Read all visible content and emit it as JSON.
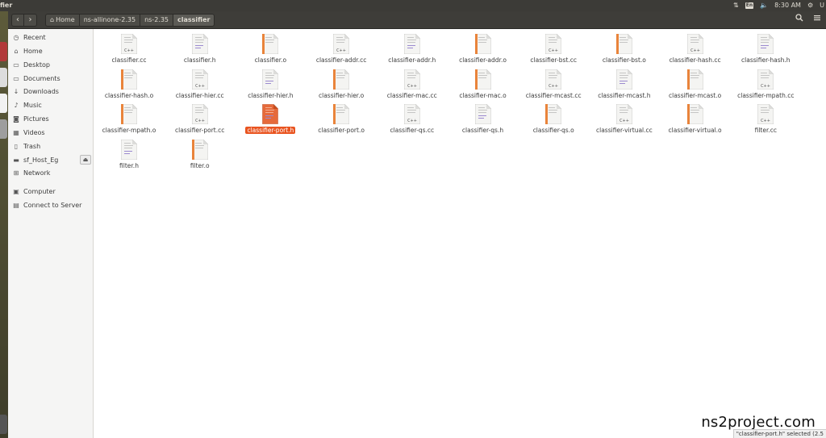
{
  "window": {
    "title_fragment": "fier"
  },
  "top_panel": {
    "network_icon": "arrows-up-down-icon",
    "keyboard": "En",
    "volume_icon": "speaker-icon",
    "time": "8:30 AM",
    "settings_icon": "gear-icon",
    "user_fragment": "U"
  },
  "nav": {
    "back": "‹",
    "forward": "›"
  },
  "breadcrumbs": [
    "Home",
    "ns-allinone-2.35",
    "ns-2.35",
    "classifier"
  ],
  "header_actions": {
    "search_icon": "search-icon",
    "menu_icon": "hamburger-menu-icon"
  },
  "sidebar": {
    "items": [
      {
        "label": "Recent",
        "icon": "clock-icon"
      },
      {
        "label": "Home",
        "icon": "home-icon"
      },
      {
        "label": "Desktop",
        "icon": "desktop-folder-icon"
      },
      {
        "label": "Documents",
        "icon": "documents-folder-icon"
      },
      {
        "label": "Downloads",
        "icon": "download-arrow-icon"
      },
      {
        "label": "Music",
        "icon": "music-note-icon"
      },
      {
        "label": "Pictures",
        "icon": "camera-icon"
      },
      {
        "label": "Videos",
        "icon": "film-icon"
      },
      {
        "label": "Trash",
        "icon": "trash-icon"
      },
      {
        "label": "sf_Host_Eg",
        "icon": "drive-icon",
        "eject": true
      },
      {
        "label": "Network",
        "icon": "network-icon"
      },
      {
        "label": "Computer",
        "icon": "computer-icon"
      },
      {
        "label": "Connect to Server",
        "icon": "server-icon"
      }
    ]
  },
  "files": [
    {
      "name": "classifier.cc",
      "kind": "cc"
    },
    {
      "name": "classifier.h",
      "kind": "h"
    },
    {
      "name": "classifier.o",
      "kind": "o"
    },
    {
      "name": "classifier-addr.cc",
      "kind": "cc"
    },
    {
      "name": "classifier-addr.h",
      "kind": "h"
    },
    {
      "name": "classifier-addr.o",
      "kind": "o"
    },
    {
      "name": "classifier-bst.cc",
      "kind": "cc"
    },
    {
      "name": "classifier-bst.o",
      "kind": "o"
    },
    {
      "name": "classifier-hash.cc",
      "kind": "cc"
    },
    {
      "name": "classifier-hash.h",
      "kind": "h"
    },
    {
      "name": "classifier-hash.o",
      "kind": "o"
    },
    {
      "name": "classifier-hier.cc",
      "kind": "cc"
    },
    {
      "name": "classifier-hier.h",
      "kind": "h"
    },
    {
      "name": "classifier-hier.o",
      "kind": "o"
    },
    {
      "name": "classifier-mac.cc",
      "kind": "cc"
    },
    {
      "name": "classifier-mac.o",
      "kind": "o"
    },
    {
      "name": "classifier-mcast.cc",
      "kind": "cc"
    },
    {
      "name": "classifier-mcast.h",
      "kind": "h"
    },
    {
      "name": "classifier-mcast.o",
      "kind": "o"
    },
    {
      "name": "classifier-mpath.cc",
      "kind": "cc"
    },
    {
      "name": "classifier-mpath.o",
      "kind": "o"
    },
    {
      "name": "classifier-port.cc",
      "kind": "cc"
    },
    {
      "name": "classifier-port.h",
      "kind": "h",
      "selected": true
    },
    {
      "name": "classifier-port.o",
      "kind": "o"
    },
    {
      "name": "classifier-qs.cc",
      "kind": "cc"
    },
    {
      "name": "classifier-qs.h",
      "kind": "h"
    },
    {
      "name": "classifier-qs.o",
      "kind": "o"
    },
    {
      "name": "classifier-virtual.cc",
      "kind": "cc"
    },
    {
      "name": "classifier-virtual.o",
      "kind": "o"
    },
    {
      "name": "filter.cc",
      "kind": "cc"
    },
    {
      "name": "filter.h",
      "kind": "h"
    },
    {
      "name": "filter.o",
      "kind": "o"
    }
  ],
  "status_bar": "\"classifier-port.h\" selected  (2.5",
  "watermark": "ns2project.com",
  "colors": {
    "accent": "#e95420",
    "panel": "#3c3b37",
    "header": "#3e3d39",
    "sidebar": "#f5f5f4"
  }
}
